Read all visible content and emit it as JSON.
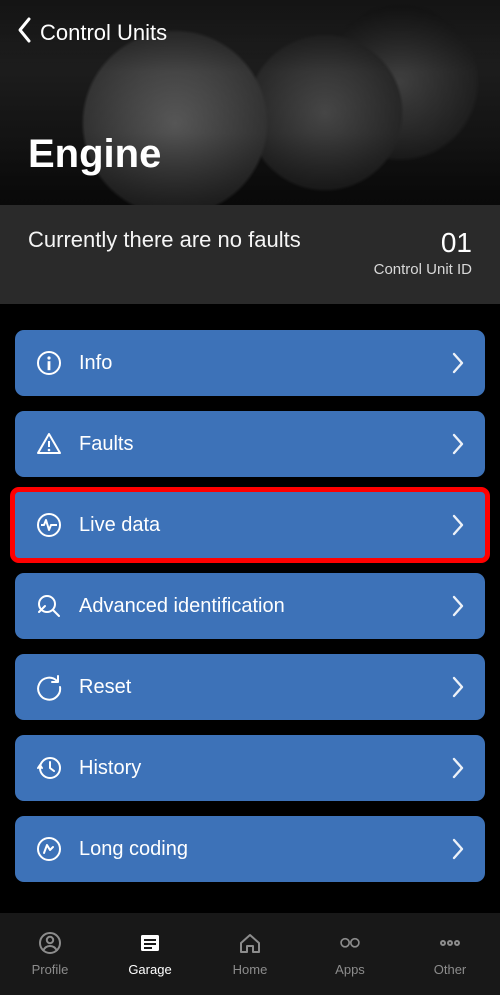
{
  "header": {
    "back_label": "Control Units",
    "title": "Engine"
  },
  "status": {
    "text": "Currently there are no faults",
    "unit_id": "01",
    "unit_id_label": "Control Unit ID"
  },
  "menu": [
    {
      "icon": "info-icon",
      "label": "Info",
      "highlight": false
    },
    {
      "icon": "faults-icon",
      "label": "Faults",
      "highlight": false
    },
    {
      "icon": "live-data-icon",
      "label": "Live data",
      "highlight": true
    },
    {
      "icon": "advanced-icon",
      "label": "Advanced identification",
      "highlight": false
    },
    {
      "icon": "reset-icon",
      "label": "Reset",
      "highlight": false
    },
    {
      "icon": "history-icon",
      "label": "History",
      "highlight": false
    },
    {
      "icon": "coding-icon",
      "label": "Long coding",
      "highlight": false
    }
  ],
  "nav": [
    {
      "icon": "profile-icon",
      "label": "Profile",
      "active": false
    },
    {
      "icon": "garage-icon",
      "label": "Garage",
      "active": true
    },
    {
      "icon": "home-icon",
      "label": "Home",
      "active": false
    },
    {
      "icon": "apps-icon",
      "label": "Apps",
      "active": false
    },
    {
      "icon": "other-icon",
      "label": "Other",
      "active": false
    }
  ],
  "colors": {
    "accent": "#3d72b8",
    "highlight": "#ff0000"
  }
}
